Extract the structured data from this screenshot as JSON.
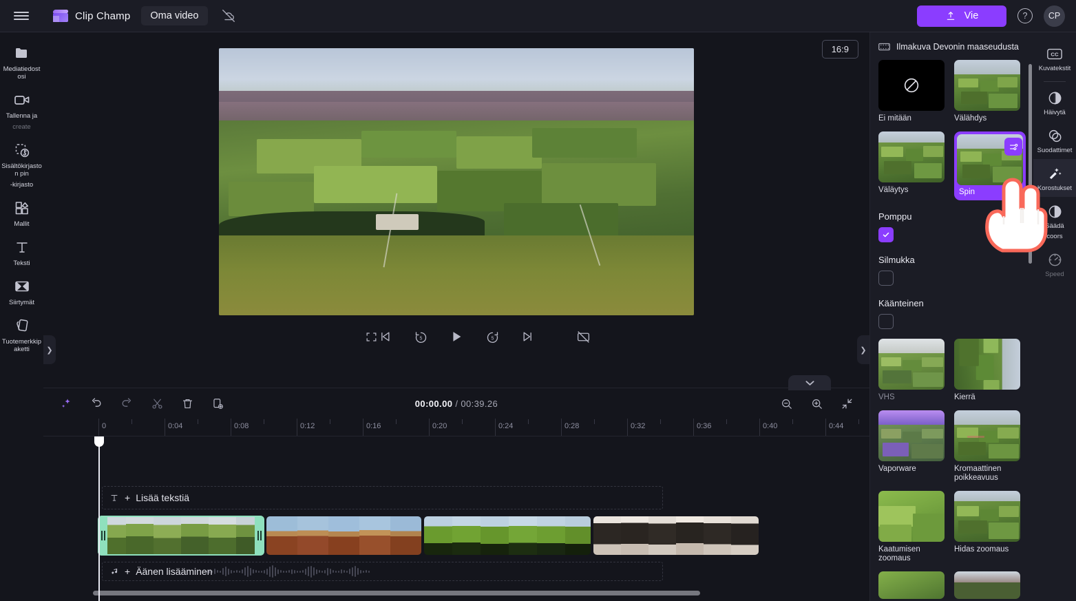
{
  "app": {
    "brand_name": "Clip Champ",
    "project_title": "Oma video",
    "menu_icon": "hamburger-icon",
    "cloud_icon": "cloud-off-icon"
  },
  "topbar": {
    "export_label": "Vie",
    "export_icon": "upload-icon",
    "help_icon": "help-circle-icon",
    "avatar_initials": "CP",
    "accent_color": "#8b3dff"
  },
  "left_rail": {
    "items": [
      {
        "label": "Mediatiedostosi",
        "icon": "folder-icon",
        "dim": false
      },
      {
        "label": "Tallenna ja",
        "label2": "create",
        "icon": "camera-icon",
        "dim": false
      },
      {
        "label": "Sisältökirjaston pin",
        "label2": "-kirjasto",
        "icon": "library-icon",
        "dim": false
      },
      {
        "label": "Mallit",
        "icon": "templates-icon",
        "dim": false
      },
      {
        "label": "Teksti",
        "icon": "text-icon",
        "dim": false
      },
      {
        "label": "Siirtymät",
        "icon": "transitions-icon",
        "dim": false
      },
      {
        "label": "Tuotemerkkipaketti",
        "icon": "brandkit-icon",
        "dim": false
      }
    ],
    "collapse_icon": "chevron-right-icon"
  },
  "preview": {
    "aspect_ratio": "16:9",
    "collapse_icon": "chevron-right-icon",
    "controls": {
      "captions_icon": "captions-off-icon",
      "skip_start_icon": "skip-to-start-icon",
      "back5_icon": "rewind-5-icon",
      "play_icon": "play-icon",
      "fwd5_icon": "forward-5-icon",
      "skip_end_icon": "skip-to-end-icon",
      "fullscreen_icon": "fullscreen-icon"
    }
  },
  "timeline": {
    "collapse_icon": "chevron-down-icon",
    "tools": [
      {
        "name": "magic-wand-icon"
      },
      {
        "name": "undo-icon"
      },
      {
        "name": "redo-icon"
      },
      {
        "name": "scissors-icon"
      },
      {
        "name": "trash-icon"
      },
      {
        "name": "duplicate-icon"
      }
    ],
    "current_time": "00:00.00",
    "total_time": "00:39.26",
    "time_separator": "/",
    "zoom_out_icon": "zoom-out-icon",
    "zoom_in_icon": "zoom-in-icon",
    "fit_icon": "fit-to-screen-icon",
    "ruler_ticks": [
      "0",
      "0:04",
      "0:08",
      "0:12",
      "0:16",
      "0:20",
      "0:24",
      "0:28",
      "0:32",
      "0:36",
      "0:40",
      "0:44"
    ],
    "text_track": {
      "label": "Lisää tekstiä",
      "plus": "+",
      "icon": "text-track-icon"
    },
    "audio_track": {
      "label": "Äänen lisääminen",
      "plus": "+",
      "icon": "music-note-icon"
    },
    "clips": [
      {
        "name": "clip-1-fields",
        "selected": true
      },
      {
        "name": "clip-2-canyon",
        "selected": false
      },
      {
        "name": "clip-3-grass",
        "selected": false
      },
      {
        "name": "clip-4-cow",
        "selected": false
      }
    ]
  },
  "right_panel": {
    "header_title": "Ilmakuva Devonin maaseudusta",
    "header_icon": "film-strip-icon",
    "settings_icon": "sliders-icon",
    "effects": [
      {
        "label": "Ei mitään",
        "kind": "none",
        "selected": false
      },
      {
        "label": "Välähdys",
        "kind": "flash",
        "selected": false
      },
      {
        "label": "Väläytys",
        "kind": "blink",
        "selected": false
      },
      {
        "label": "Spin",
        "kind": "spin",
        "selected": true
      },
      {
        "label": "VHS",
        "kind": "vhs",
        "selected": false,
        "dim": true
      },
      {
        "label": "Kierrä",
        "kind": "rotate",
        "selected": false
      },
      {
        "label": "Vaporware",
        "kind": "vapor",
        "selected": false
      },
      {
        "label": "Kromaattinen poikkeavuus",
        "kind": "chroma",
        "selected": false
      },
      {
        "label": "Kaatumisen zoomaus",
        "kind": "fallzoom",
        "selected": false
      },
      {
        "label": "Hidas zoomaus",
        "kind": "slowzoom",
        "selected": false
      }
    ],
    "options": [
      {
        "label": "Pomppu",
        "checked": true
      },
      {
        "label": "Silmukka",
        "checked": false
      },
      {
        "label": "Käänteinen",
        "checked": false
      }
    ]
  },
  "far_rail": {
    "items": [
      {
        "label": "Kuvatekstit",
        "icon": "closed-captions-icon",
        "selected": false,
        "dim": false
      },
      {
        "label": "Häivytä",
        "icon": "fade-icon",
        "selected": false,
        "dim": false
      },
      {
        "label": "Suodattimet",
        "icon": "filters-icon",
        "selected": false,
        "dim": false
      },
      {
        "label": "Korostukset",
        "icon": "effects-wand-icon",
        "selected": true,
        "dim": false
      },
      {
        "label": "Säädä",
        "label2": "coors",
        "icon": "adjust-color-icon",
        "selected": false,
        "dim": false
      },
      {
        "label": "Speed",
        "icon": "speed-gauge-icon",
        "selected": false,
        "dim": true
      }
    ]
  },
  "cursor": {
    "type": "pointing-hand-cursor"
  }
}
